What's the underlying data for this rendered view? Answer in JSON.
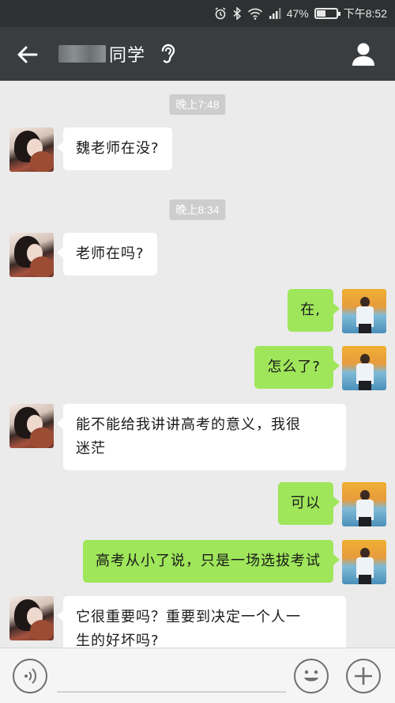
{
  "status_bar": {
    "battery_text": "47%",
    "battery_level": 0.47,
    "time": "下午8:52"
  },
  "header": {
    "title": "同学"
  },
  "messages": [
    {
      "type": "timestamp",
      "text": "晚上7:48"
    },
    {
      "type": "received",
      "text": "魏老师在没?"
    },
    {
      "type": "timestamp",
      "text": "晚上8:34"
    },
    {
      "type": "received",
      "text": "老师在吗?"
    },
    {
      "type": "sent",
      "text": "在,"
    },
    {
      "type": "sent",
      "text": "怎么了?"
    },
    {
      "type": "received",
      "lines": [
        "能不能给我讲讲高考的意义，我很",
        "迷茫"
      ]
    },
    {
      "type": "sent",
      "text": "可以"
    },
    {
      "type": "sent",
      "text": "高考从小了说，只是一场选拔考试"
    },
    {
      "type": "received",
      "lines": [
        "它很重要吗？重要到决定一个人一",
        "生的好坏吗?"
      ]
    }
  ],
  "colors": {
    "status_bar": "#2e3132",
    "title_bar": "#3a3d3f",
    "chat_bg": "#ebebeb",
    "sent_bubble": "#9fe65b",
    "received_bubble": "#ffffff"
  },
  "icons": {
    "back": "arrow-left-icon",
    "voice_call": "ear-icon",
    "profile": "person-icon",
    "voice_input": "voice-icon",
    "emoji": "smiley-icon",
    "more": "plus-icon"
  }
}
